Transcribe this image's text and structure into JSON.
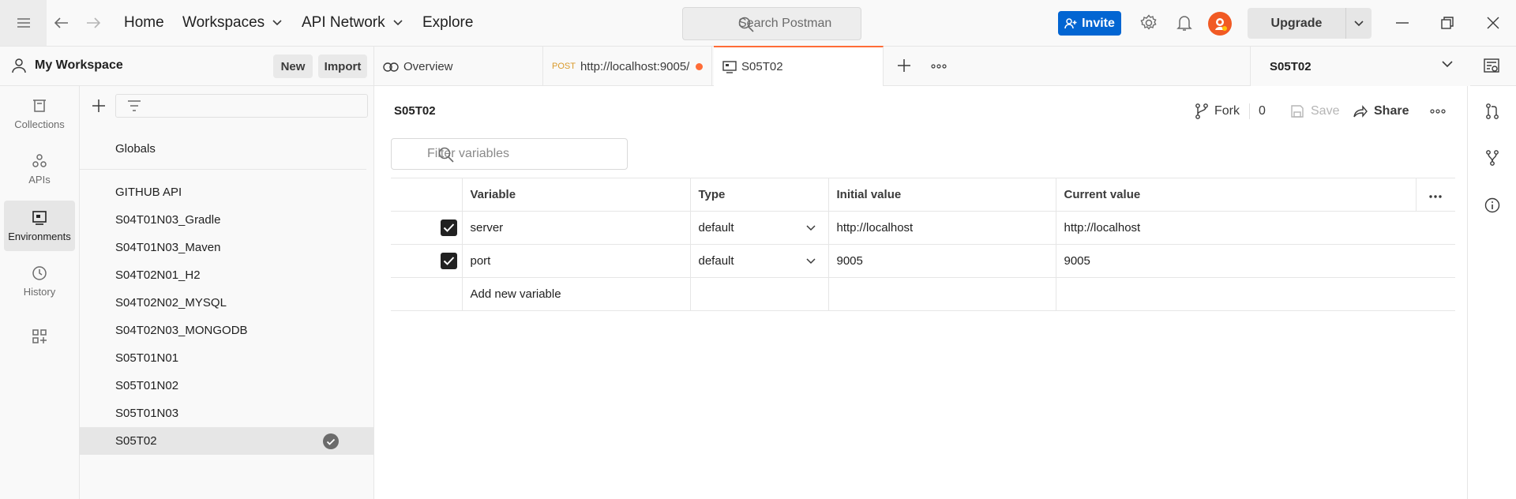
{
  "topbar": {
    "nav": [
      {
        "label": "Home",
        "has_dropdown": false
      },
      {
        "label": "Workspaces",
        "has_dropdown": true
      },
      {
        "label": "API Network",
        "has_dropdown": true
      },
      {
        "label": "Explore",
        "has_dropdown": false
      }
    ],
    "search_placeholder": "Search Postman",
    "invite_label": "Invite",
    "upgrade_label": "Upgrade",
    "colors": {
      "invite_bg": "#0265d2",
      "accent": "#ff6c37",
      "avatar": "#f15a24"
    }
  },
  "workspace": {
    "title": "My Workspace",
    "new_label": "New",
    "import_label": "Import"
  },
  "rail": [
    {
      "label": "Collections",
      "icon": "collections-icon",
      "active": false
    },
    {
      "label": "APIs",
      "icon": "apis-icon",
      "active": false
    },
    {
      "label": "Environments",
      "icon": "environments-icon",
      "active": true
    },
    {
      "label": "History",
      "icon": "history-icon",
      "active": false
    }
  ],
  "sidebar": {
    "globals": "Globals",
    "environments": [
      {
        "label": "GITHUB API",
        "active": false
      },
      {
        "label": "S04T01N03_Gradle",
        "active": false
      },
      {
        "label": "S04T01N03_Maven",
        "active": false
      },
      {
        "label": "S04T02N01_H2",
        "active": false
      },
      {
        "label": "S04T02N02_MYSQL",
        "active": false
      },
      {
        "label": "S04T02N03_MONGODB",
        "active": false
      },
      {
        "label": "S05T01N01",
        "active": false
      },
      {
        "label": "S05T01N02",
        "active": false
      },
      {
        "label": "S05T01N03",
        "active": false
      },
      {
        "label": "S05T02",
        "active": true
      }
    ]
  },
  "tabs": [
    {
      "label": "Overview",
      "icon": "overview-icon",
      "method": "",
      "unsaved": false,
      "active": false
    },
    {
      "label": "http://localhost:9005/",
      "icon": "",
      "method": "POST",
      "unsaved": true,
      "active": false
    },
    {
      "label": "S05T02",
      "icon": "environment-tab-icon",
      "method": "",
      "unsaved": false,
      "active": true
    }
  ],
  "env_selector": {
    "selected": "S05T02"
  },
  "main": {
    "title": "S05T02",
    "fork_label": "Fork",
    "fork_count": "0",
    "save_label": "Save",
    "share_label": "Share",
    "filter_placeholder": "Filter variables",
    "columns": [
      "Variable",
      "Type",
      "Initial value",
      "Current value"
    ],
    "rows": [
      {
        "enabled": true,
        "variable": "server",
        "type": "default",
        "initial": "http://localhost",
        "current": "http://localhost"
      },
      {
        "enabled": true,
        "variable": "port",
        "type": "default",
        "initial": "9005",
        "current": "9005"
      }
    ],
    "add_placeholder": "Add new variable"
  }
}
